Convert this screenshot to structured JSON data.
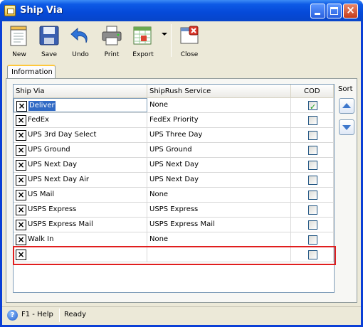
{
  "window": {
    "title": "Ship Via"
  },
  "toolbar": {
    "buttons": [
      {
        "label": "New",
        "icon": "new-document-icon"
      },
      {
        "label": "Save",
        "icon": "floppy-disk-icon"
      },
      {
        "label": "Undo",
        "icon": "undo-arrow-icon"
      },
      {
        "label": "Print",
        "icon": "printer-icon"
      },
      {
        "label": "Export",
        "icon": "export-spreadsheet-icon"
      },
      {
        "label": "Close",
        "icon": "close-form-icon"
      }
    ]
  },
  "tabs": [
    {
      "label": "Information",
      "active": true
    }
  ],
  "grid": {
    "columns": [
      "Ship Via",
      "ShipRush Service",
      "COD"
    ],
    "rows": [
      {
        "ship_via": "Deliver",
        "service": "None",
        "cod": true,
        "selected": true
      },
      {
        "ship_via": "FedEx",
        "service": "FedEx Priority",
        "cod": false
      },
      {
        "ship_via": "UPS 3rd Day Select",
        "service": "UPS Three Day",
        "cod": false
      },
      {
        "ship_via": "UPS Ground",
        "service": "UPS Ground",
        "cod": false
      },
      {
        "ship_via": "UPS Next Day",
        "service": "UPS Next Day",
        "cod": false
      },
      {
        "ship_via": "UPS Next Day Air",
        "service": "UPS Next Day",
        "cod": false
      },
      {
        "ship_via": "US Mail",
        "service": "None",
        "cod": false
      },
      {
        "ship_via": "USPS Express",
        "service": "USPS Express",
        "cod": false
      },
      {
        "ship_via": "USPS Express Mail",
        "service": "USPS Express Mail",
        "cod": false
      },
      {
        "ship_via": "Walk In",
        "service": "None",
        "cod": false
      },
      {
        "ship_via": "",
        "service": "",
        "cod": false,
        "new_row": true
      }
    ],
    "highlight_color": "#e01e1e"
  },
  "sort": {
    "label": "Sort"
  },
  "status": {
    "help": "F1 - Help",
    "state": "Ready"
  },
  "colors": {
    "title_bar": "#0549d8",
    "selection": "#316ac5",
    "window_bg": "#ece9d8"
  }
}
